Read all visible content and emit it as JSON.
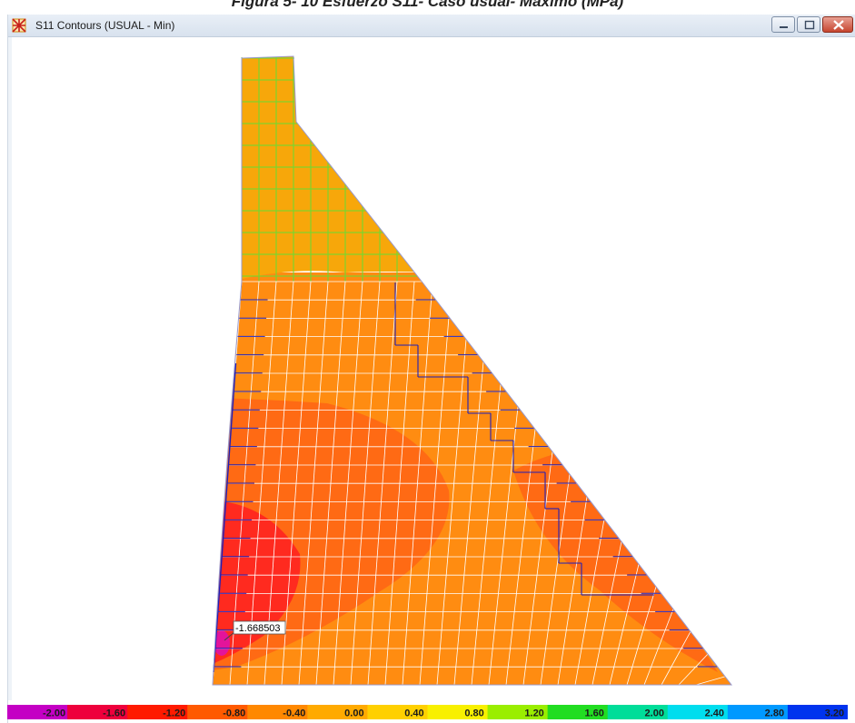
{
  "figure_caption": "Figura 5- 10 Esfuerzo S11- Caso usual- Máximo (MPa)",
  "window": {
    "title": "S11 Contours  (USUAL - Min)",
    "icons": {
      "app": "app-grid-icon",
      "minimize": "minimize-icon",
      "maximize": "maximize-icon",
      "close": "close-icon"
    }
  },
  "annotation": {
    "value": "-1.668503"
  },
  "legend": {
    "labels": [
      "-2.00",
      "-1.60",
      "-1.20",
      "-0.80",
      "-0.40",
      "0.00",
      "0.40",
      "0.80",
      "1.20",
      "1.60",
      "2.00",
      "2.40",
      "2.80",
      "3.20"
    ],
    "colors": [
      "#c400c4",
      "#ee003c",
      "#ff1a00",
      "#ff5a00",
      "#ff8800",
      "#ffaa00",
      "#ffd000",
      "#f8f000",
      "#9aee00",
      "#22dd22",
      "#00dd99",
      "#00ddee",
      "#0099ff",
      "#0033ee"
    ]
  },
  "contour_colors": {
    "top_block": "#f7a70a",
    "body": "#ff8c11",
    "inner_high": "#ff6a14",
    "core": "#ff2a1f",
    "hotspot": "#e3149a",
    "mesh_light": "#ffffff",
    "mesh_dark": "#1f1fb8",
    "edge_top": "#66dd33"
  }
}
